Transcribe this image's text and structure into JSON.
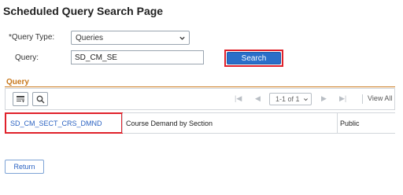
{
  "page": {
    "title": "Scheduled Query Search Page"
  },
  "form": {
    "query_type_label": "Query Type:",
    "required_marker": "*",
    "query_type_value": "Queries",
    "query_label": "Query:",
    "query_value": "SD_CM_SE",
    "search_label": "Search"
  },
  "grid": {
    "title": "Query",
    "pager": {
      "range": "1-1 of 1",
      "view_all": "View All"
    },
    "rows": [
      {
        "name": "SD_CM_SECT_CRS_DMND",
        "description": "Course Demand by Section",
        "access": "Public"
      }
    ]
  },
  "footer": {
    "return_label": "Return"
  },
  "colors": {
    "accent": "#2a6fc9",
    "highlight": "#e0212b",
    "grid_title": "#c8771a"
  }
}
